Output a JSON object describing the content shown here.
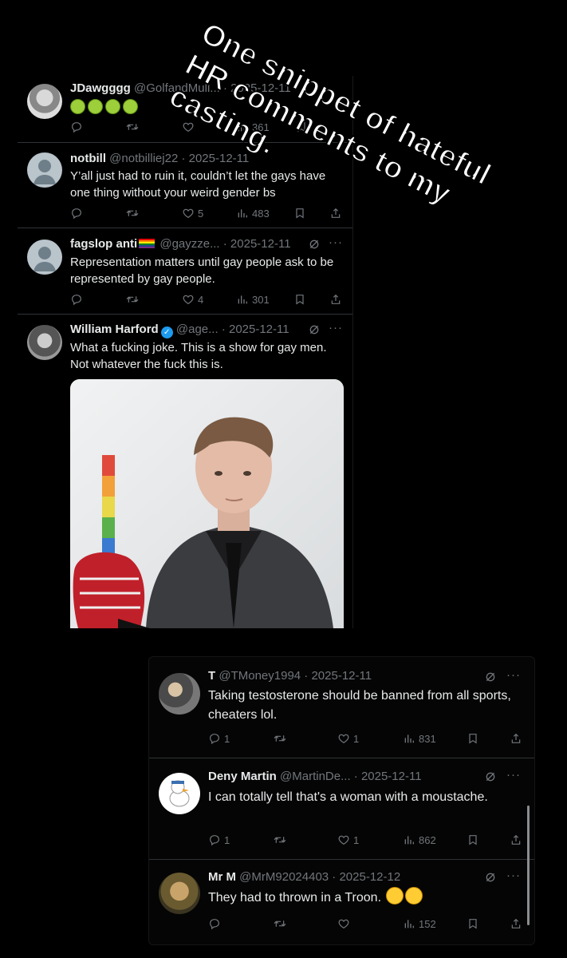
{
  "overlay": {
    "text": "One snippet of hateful HR comments to my casting."
  },
  "tweets_a": [
    {
      "name": "JDawgggg",
      "handle": "@GolfandMull... · 2025-12-11",
      "body": "",
      "emoji_count": 4,
      "actions": {
        "reply": "",
        "retweet": "",
        "like": "",
        "views": "361"
      }
    },
    {
      "name": "notbill",
      "handle": "@notbilliej22 · 2025-12-11",
      "body": "Y’all just had to ruin it, couldn’t let the gays have one thing without your weird gender bs",
      "actions": {
        "reply": "",
        "retweet": "",
        "like": "5",
        "views": "483"
      }
    },
    {
      "name": "fagslop anti",
      "handle": "@gayzze... · 2025-12-11",
      "body": "Representation matters until gay people ask to be represented by gay people.",
      "actions": {
        "reply": "",
        "retweet": "",
        "like": "4",
        "views": "301"
      }
    },
    {
      "name": "William Harford",
      "handle": "@age... · 2025-12-11",
      "body": "What a fucking joke. This is a show for gay men. Not whatever the fuck this is.",
      "actions": {
        "reply": "",
        "retweet": "",
        "like": "",
        "views": ""
      }
    }
  ],
  "tweets_b": [
    {
      "name": "T",
      "handle": "@TMoney1994 · 2025-12-11",
      "body": "Taking testosterone should be banned from all sports, cheaters lol.",
      "actions": {
        "reply": "1",
        "retweet": "",
        "like": "1",
        "views": "831"
      }
    },
    {
      "name": "Deny Martin",
      "handle": "@MartinDe... · 2025-12-11",
      "body": "I can totally tell that's a woman with a moustache.",
      "actions": {
        "reply": "1",
        "retweet": "",
        "like": "1",
        "views": "862"
      }
    },
    {
      "name": "Mr M",
      "handle": "@MrM92024403 · 2025-12-12",
      "body": "They had to thrown in a Troon.",
      "actions": {
        "reply": "",
        "retweet": "",
        "like": "",
        "views": "152"
      }
    }
  ],
  "colors": {
    "background": "#000000",
    "text": "#e7e9ea",
    "muted": "#71767b",
    "verified": "#1d9bf0",
    "divider": "#2f3336"
  },
  "icons": [
    "reply-icon",
    "retweet-icon",
    "like-icon",
    "views-icon",
    "bookmark-icon",
    "share-icon",
    "grok-icon",
    "more-icon",
    "verified-icon",
    "pride-flag-icon"
  ]
}
